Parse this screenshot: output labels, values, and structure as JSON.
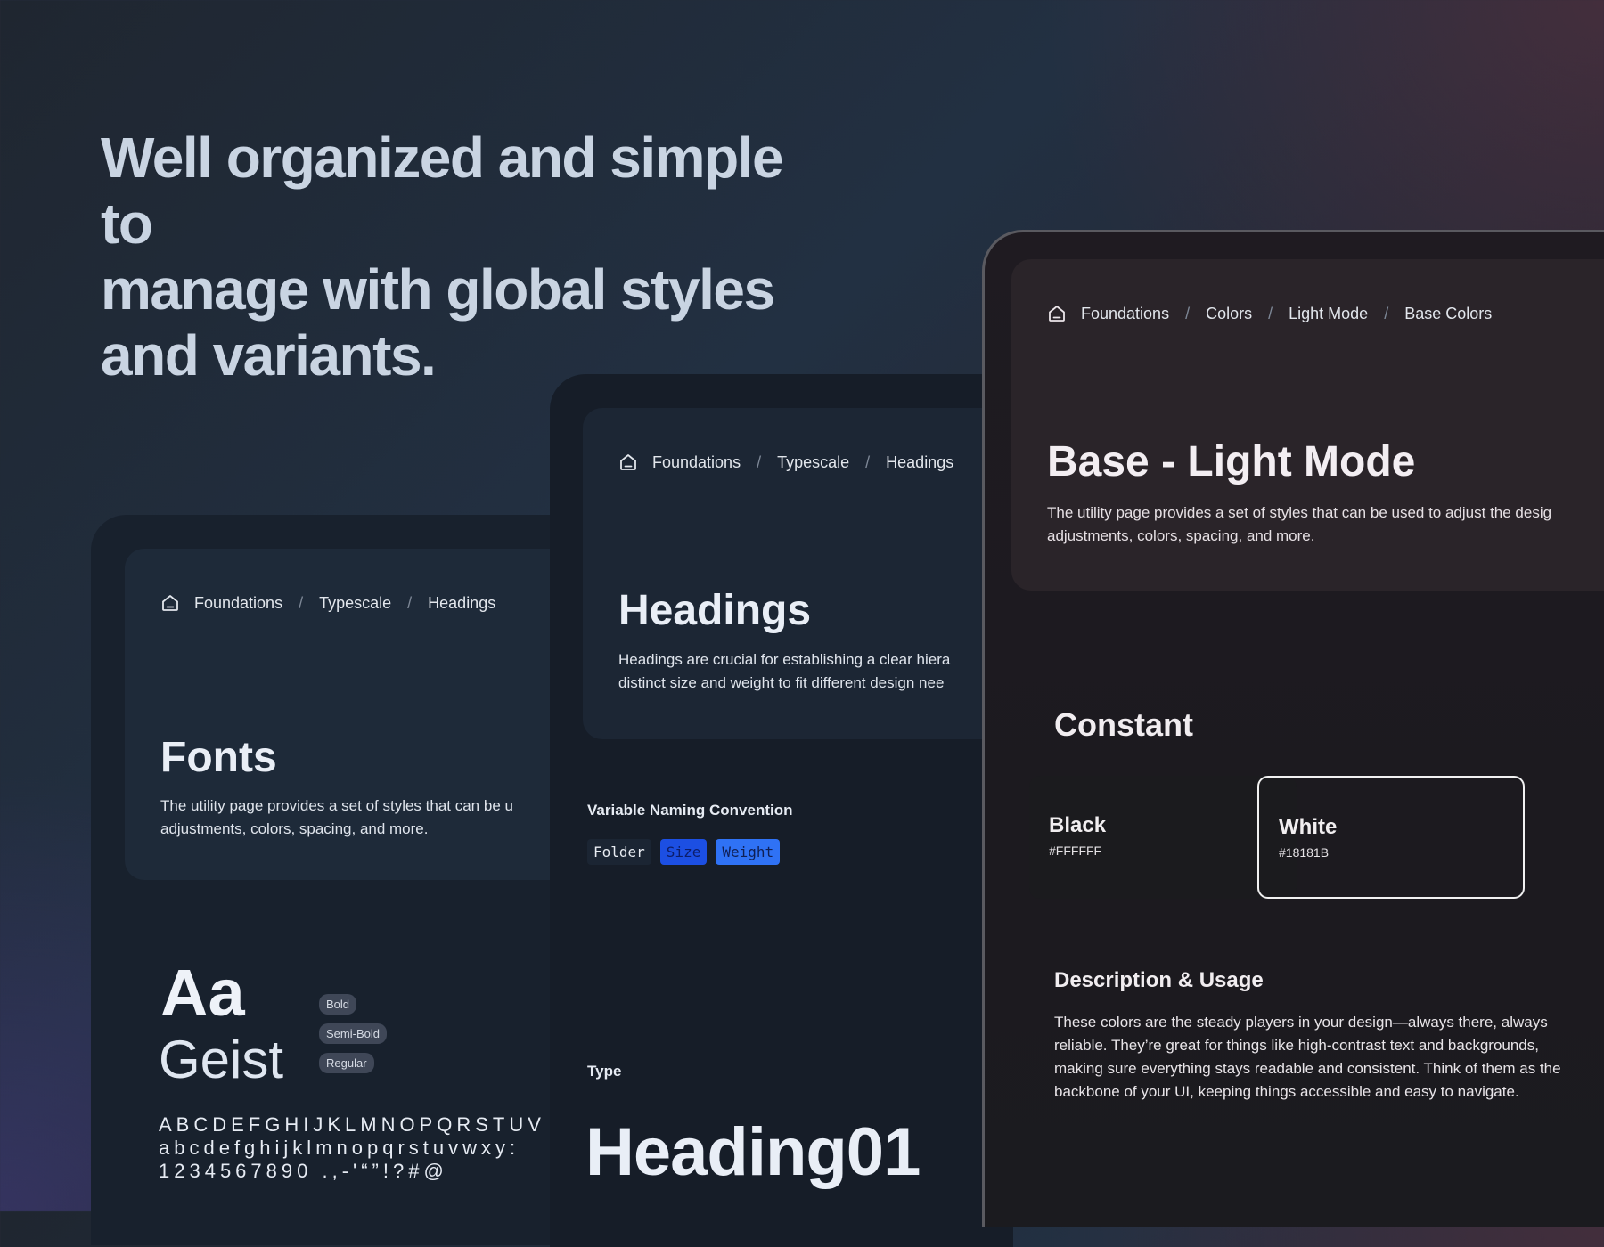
{
  "hero": {
    "line1": "Well organized and simple to",
    "line2": "manage with global styles",
    "line3": "and variants."
  },
  "fonts_page": {
    "breadcrumb": [
      "Foundations",
      "Typescale",
      "Headings"
    ],
    "title": "Fonts",
    "desc_line1": "The utility page provides a set of styles that can be u",
    "desc_line2": "adjustments, colors, spacing, and more.",
    "specimen": {
      "aa": "Aa",
      "font_name": "Geist"
    },
    "weights": [
      "Bold",
      "Semi-Bold",
      "Regular"
    ],
    "glyphs": {
      "upper": "ABCDEFGHIJKLMNOPQRSTUV",
      "lower": "abcdefghijklmnopqrstuvwxy:",
      "numbers": "1234567890 .,-'“”!?#@"
    }
  },
  "headings_page": {
    "breadcrumb": [
      "Foundations",
      "Typescale",
      "Headings"
    ],
    "title": "Headings",
    "desc_line1": "Headings are crucial for establishing a clear hiera",
    "desc_line2": "distinct size and weight to fit different design nee",
    "naming_label": "Variable Naming Convention",
    "naming_tokens": {
      "folder": "Folder",
      "size": "Size",
      "weight": "Weight"
    },
    "type_label": "Type",
    "type_sample": "Heading01"
  },
  "colors_page": {
    "breadcrumb": [
      "Foundations",
      "Colors",
      "Light Mode",
      "Base Colors"
    ],
    "title": "Base - Light Mode",
    "desc_line1": "The utility page provides a set of styles that can be used to adjust the desig",
    "desc_line2": "adjustments, colors, spacing, and more.",
    "constant_title": "Constant",
    "swatches": [
      {
        "name": "Black",
        "hex": "#FFFFFF"
      },
      {
        "name": "White",
        "hex": "#18181B"
      }
    ],
    "usage_title": "Description & Usage",
    "usage_body": "These colors are the steady players in your design—always there, always reliable. They’re great for things like high-contrast text and backgrounds, making sure everything stays readable and consistent. Think of them as the backbone of your UI, keeping things accessible and easy to navigate."
  },
  "icons": {
    "home": "home-icon"
  },
  "colors": {
    "token_size_bg": "#1c4fe3",
    "token_weight_bg": "#2f72f5"
  }
}
